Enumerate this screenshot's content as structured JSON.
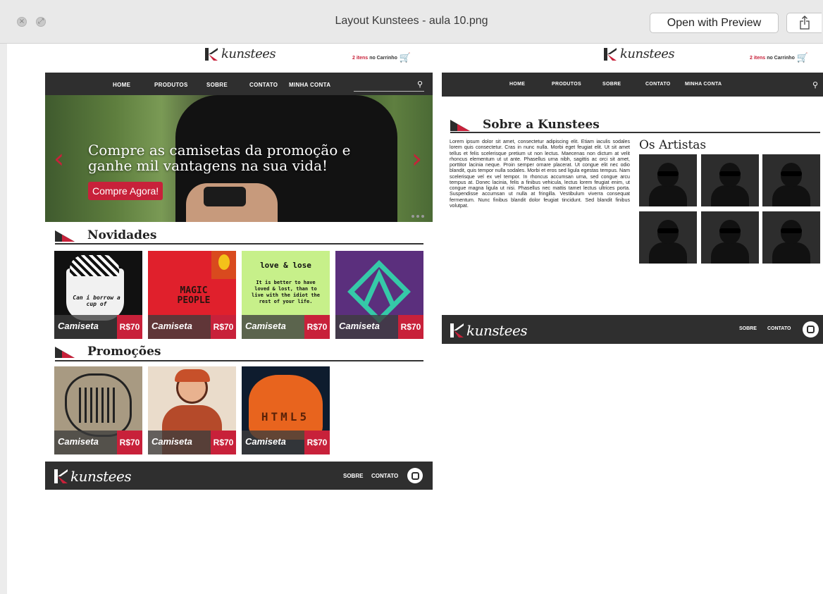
{
  "window": {
    "title": "Layout Kunstees - aula 10.png",
    "open_button": "Open with Preview",
    "share_icon": "share-icon",
    "close_icon": "close-icon",
    "fullscreen_icon": "fullscreen-icon"
  },
  "colors": {
    "accent": "#c8213a",
    "dark": "#2f2f2f",
    "text": "#222222"
  },
  "brand": {
    "name": "kunstees"
  },
  "cart": {
    "count": "2 itens",
    "text": "no Carrinho"
  },
  "nav": {
    "items": [
      "HOME",
      "PRODUTOS",
      "SOBRE",
      "CONTATO",
      "MINHA CONTA"
    ]
  },
  "hero": {
    "headline": "Compre as camisetas da promoção e ganhe mil vantagens na sua vida!",
    "cta": "Compre Agora!"
  },
  "sections": {
    "novidades": "Novidades",
    "promocoes": "Promoções",
    "sobre": "Sobre a Kunstees",
    "artistas": "Os Artistas"
  },
  "products": {
    "novidades": [
      {
        "name": "Camiseta",
        "price": "R$70"
      },
      {
        "name": "Camiseta",
        "price": "R$70"
      },
      {
        "name": "Camiseta",
        "price": "R$70"
      },
      {
        "name": "Camiseta",
        "price": "R$70"
      }
    ],
    "promocoes": [
      {
        "name": "Camiseta",
        "price": "R$70"
      },
      {
        "name": "Camiseta",
        "price": "R$70"
      },
      {
        "name": "Camiseta",
        "price": "R$70"
      }
    ]
  },
  "art": {
    "love_title": "love & lose",
    "love_quote": "It is better to have loved & lost, than to live with the idiot the rest of your life.",
    "magic": "MAGIC PEOPLE",
    "html": "HTML5"
  },
  "about": {
    "text": "Lorem ipsum dolor sit amet, consectetur adipiscing elit. Etiam iaculis sodales lorem quis consectetur. Cras in nunc nulla. Morbi eget feugiat elit. Ut sit amet tellus et felis scelerisque pretium ut non lectus. Maecenas non dictum at velit rhoncus elementum ut ut ante. Phasellus urna nibh, sagittis ac orci sit amet, porttitor lacinia neque. Proin semper ornare placerat. Ut congue elit nec odio blandit, quis tempor nulla sodales. Morbi et eros sed ligula egestas tempus. Nam scelerisque vel ex vel tempor. In rhoncus accumsan urna, sed congue arcu tempus at. Donec lacinia, felis a finibus vehicula, lectus lorem feugiat enim, ut congue magna ligula ut nisi. Phasellus nec mattis tamet lectus ultrices porta. Suspendisse accumsan ut nulla at fringilla. Vestibulum viverra consequat fermentum. Nunc finibus blandit dolor feugiat tincidunt. Sed blandit finibus volutpat."
  },
  "footer": {
    "links": [
      "SOBRE",
      "CONTATO"
    ],
    "instagram_icon": "instagram-icon"
  }
}
